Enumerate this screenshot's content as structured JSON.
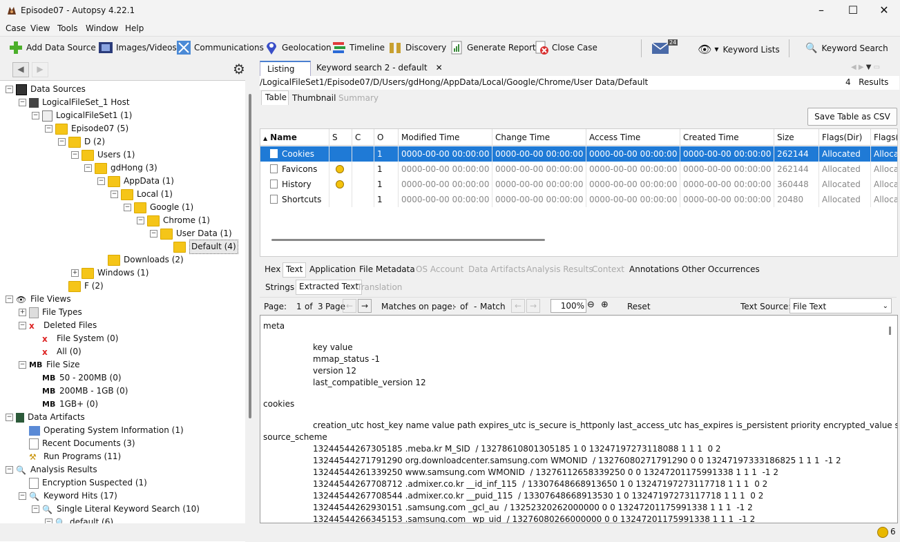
{
  "window": {
    "title": "Episode07 - Autopsy 4.22.1"
  },
  "menu": [
    "Case",
    "View",
    "Tools",
    "Window",
    "Help"
  ],
  "toolbar": {
    "add_data_source": "Add Data Source",
    "images_videos": "Images/Videos",
    "communications": "Communications",
    "geolocation": "Geolocation",
    "timeline": "Timeline",
    "discovery": "Discovery",
    "generate_report": "Generate Report",
    "close_case": "Close Case",
    "mail_badge": "24",
    "keyword_lists": "Keyword Lists",
    "keyword_search": "Keyword Search"
  },
  "tree": [
    {
      "label": "Data Sources",
      "level": 0,
      "exp": "-",
      "icon": "datasource"
    },
    {
      "label": "LogicalFileSet_1 Host",
      "level": 1,
      "exp": "-",
      "icon": "host"
    },
    {
      "label": "LogicalFileSet1 (1)",
      "level": 2,
      "exp": "-",
      "icon": "fileset"
    },
    {
      "label": "Episode07 (5)",
      "level": 3,
      "exp": "-",
      "icon": "folder"
    },
    {
      "label": "D (2)",
      "level": 4,
      "exp": "-",
      "icon": "folder"
    },
    {
      "label": "Users (1)",
      "level": 5,
      "exp": "-",
      "icon": "folder"
    },
    {
      "label": "gdHong (3)",
      "level": 6,
      "exp": "-",
      "icon": "folder"
    },
    {
      "label": "AppData (1)",
      "level": 7,
      "exp": "-",
      "icon": "folder"
    },
    {
      "label": "Local (1)",
      "level": 8,
      "exp": "-",
      "icon": "folder"
    },
    {
      "label": "Google (1)",
      "level": 9,
      "exp": "-",
      "icon": "folder"
    },
    {
      "label": "Chrome (1)",
      "level": 10,
      "exp": "-",
      "icon": "folder"
    },
    {
      "label": "User Data (1)",
      "level": 11,
      "exp": "-",
      "icon": "folder"
    },
    {
      "label": "Default (4)",
      "level": 12,
      "exp": "",
      "icon": "folder",
      "selected": true
    },
    {
      "label": "Downloads (2)",
      "level": 7,
      "exp": "",
      "icon": "folder"
    },
    {
      "label": "Windows (1)",
      "level": 5,
      "exp": "+",
      "icon": "folder"
    },
    {
      "label": "F (2)",
      "level": 4,
      "exp": "",
      "icon": "folder"
    },
    {
      "label": "File Views",
      "level": 0,
      "exp": "-",
      "icon": "eye"
    },
    {
      "label": "File Types",
      "level": 1,
      "exp": "+",
      "icon": "filetypes"
    },
    {
      "label": "Deleted Files",
      "level": 1,
      "exp": "-",
      "icon": "redx"
    },
    {
      "label": "File System (0)",
      "level": 2,
      "exp": "",
      "icon": "redx"
    },
    {
      "label": "All (0)",
      "level": 2,
      "exp": "",
      "icon": "redx"
    },
    {
      "label": "File Size",
      "level": 1,
      "exp": "-",
      "icon": "mb"
    },
    {
      "label": "50 - 200MB (0)",
      "level": 2,
      "exp": "",
      "icon": "mb"
    },
    {
      "label": "200MB - 1GB (0)",
      "level": 2,
      "exp": "",
      "icon": "mb"
    },
    {
      "label": "1GB+ (0)",
      "level": 2,
      "exp": "",
      "icon": "mb"
    },
    {
      "label": "Data Artifacts",
      "level": 0,
      "exp": "-",
      "icon": "artifacts"
    },
    {
      "label": "Operating System Information (1)",
      "level": 1,
      "exp": "",
      "icon": "os"
    },
    {
      "label": "Recent Documents (3)",
      "level": 1,
      "exp": "",
      "icon": "doc"
    },
    {
      "label": "Run Programs (11)",
      "level": 1,
      "exp": "",
      "icon": "run"
    },
    {
      "label": "Analysis Results",
      "level": 0,
      "exp": "-",
      "icon": "search"
    },
    {
      "label": "Encryption Suspected (1)",
      "level": 1,
      "exp": "",
      "icon": "doc"
    },
    {
      "label": "Keyword Hits (17)",
      "level": 1,
      "exp": "-",
      "icon": "search"
    },
    {
      "label": "Single Literal Keyword Search (10)",
      "level": 2,
      "exp": "-",
      "icon": "search"
    },
    {
      "label": "default (6)",
      "level": 3,
      "exp": "-",
      "icon": "search"
    }
  ],
  "result_tabs": {
    "listing": "Listing",
    "keyword": "Keyword search 2 - default"
  },
  "path": "/LogicalFileSet1/Episode07/D/Users/gdHong/AppData/Local/Google/Chrome/User Data/Default",
  "results_count": "4   Results",
  "view_tabs": [
    "Table",
    "Thumbnail",
    "Summary"
  ],
  "save_csv": "Save Table as CSV",
  "columns": [
    "Name",
    "S",
    "C",
    "O",
    "Modified Time",
    "Change Time",
    "Access Time",
    "Created Time",
    "Size",
    "Flags(Dir)",
    "Flags(M"
  ],
  "rows": [
    {
      "name": "Cookies",
      "s": "",
      "o": "1",
      "mtime": "0000-00-00 00:00:00",
      "ctime": "0000-00-00 00:00:00",
      "atime": "0000-00-00 00:00:00",
      "crtime": "0000-00-00 00:00:00",
      "size": "262144",
      "flags_dir": "Allocated",
      "flags_meta": "Allocat"
    },
    {
      "name": "Favicons",
      "s": "warn",
      "o": "1",
      "mtime": "0000-00-00 00:00:00",
      "ctime": "0000-00-00 00:00:00",
      "atime": "0000-00-00 00:00:00",
      "crtime": "0000-00-00 00:00:00",
      "size": "262144",
      "flags_dir": "Allocated",
      "flags_meta": "Allocat"
    },
    {
      "name": "History",
      "s": "warn",
      "o": "1",
      "mtime": "0000-00-00 00:00:00",
      "ctime": "0000-00-00 00:00:00",
      "atime": "0000-00-00 00:00:00",
      "crtime": "0000-00-00 00:00:00",
      "size": "360448",
      "flags_dir": "Allocated",
      "flags_meta": "Allocat"
    },
    {
      "name": "Shortcuts",
      "s": "",
      "o": "1",
      "mtime": "0000-00-00 00:00:00",
      "ctime": "0000-00-00 00:00:00",
      "atime": "0000-00-00 00:00:00",
      "crtime": "0000-00-00 00:00:00",
      "size": "20480",
      "flags_dir": "Allocated",
      "flags_meta": "Allocat"
    }
  ],
  "content_tabs": [
    "Hex",
    "Text",
    "Application",
    "File Metadata",
    "OS Account",
    "Data Artifacts",
    "Analysis Results",
    "Context",
    "Annotations",
    "Other Occurrences"
  ],
  "text_subtabs": [
    "Strings",
    "Extracted Text",
    "Translation"
  ],
  "pager": {
    "page_label": "Page:",
    "page": "1",
    "of": "of",
    "total": "3",
    "page_word": "Page",
    "matches": "Matches on page:",
    "dash1": "-",
    "of2": "of",
    "dash2": "-",
    "match": "Match",
    "zoom": "100%",
    "reset": "Reset",
    "source_label": "Text Source:",
    "source_value": "File Text"
  },
  "text_lines": [
    {
      "t": "meta",
      "indent": 0
    },
    {
      "t": "",
      "indent": 0
    },
    {
      "t": "key value",
      "indent": 1
    },
    {
      "t": "mmap_status -1",
      "indent": 1
    },
    {
      "t": "version 12",
      "indent": 1
    },
    {
      "t": "last_compatible_version 12",
      "indent": 1
    },
    {
      "t": "",
      "indent": 0
    },
    {
      "t": "cookies",
      "indent": 0
    },
    {
      "t": "",
      "indent": 0
    },
    {
      "t": "creation_utc host_key name value path expires_utc is_secure is_httponly last_access_utc has_expires is_persistent priority encrypted_value samesite",
      "indent": 1
    },
    {
      "t": "source_scheme",
      "indent": 0
    },
    {
      "t": "13244544267305185 .meba.kr M_SID  / 13278610801305185 1 0 13247197273118088 1 1 1  0 2",
      "indent": 1
    },
    {
      "t": "13244544271791290 org.downloadcenter.samsung.com WMONID  / 13276080271791290 0 0 13247197333186825 1 1 1  -1 2",
      "indent": 1
    },
    {
      "t": "13244544261339250 www.samsung.com WMONID  / 13276112658339250 0 0 13247201175991338 1 1 1  -1 2",
      "indent": 1
    },
    {
      "t": "13244544267708712 .admixer.co.kr __id_inf_115  / 13307648668913650 1 0 13247197273117718 1 1 1  0 2",
      "indent": 1
    },
    {
      "t": "13244544267708544 .admixer.co.kr __puid_115  / 13307648668913530 1 0 13247197273117718 1 1 1  0 2",
      "indent": 1
    },
    {
      "t": "13244544262930151 .samsung.com _gcl_au  / 13252320262000000 0 0 13247201175991338 1 1 1  -1 2",
      "indent": 1
    },
    {
      "t": "13244544266345153 .samsung.com _wp_uid  / 13276080266000000 0 0 13247201175991338 1 1 1  -1 2",
      "indent": 1
    }
  ],
  "status": {
    "notifications": "6"
  }
}
